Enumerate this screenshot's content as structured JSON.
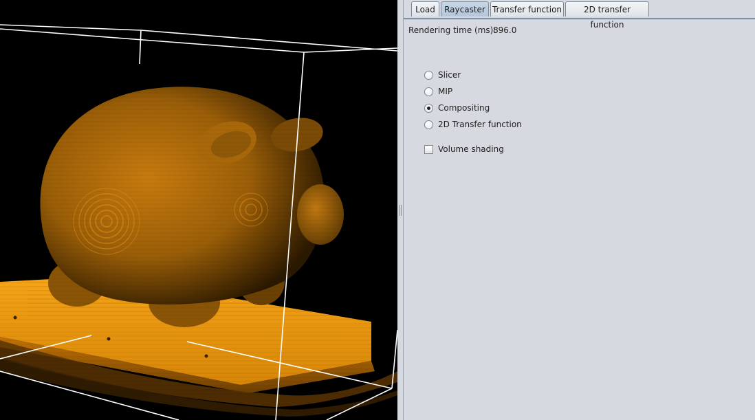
{
  "viewport": {
    "volume_color": "#f29a12",
    "background_color": "#000000",
    "bounding_box_color": "#ffffff"
  },
  "tabs": [
    {
      "label": "Load",
      "selected": false
    },
    {
      "label": "Raycaster",
      "selected": true
    },
    {
      "label": "Transfer function",
      "selected": false
    },
    {
      "label": "2D transfer function",
      "selected": false
    }
  ],
  "raycaster": {
    "rendering_time_label": "Rendering time (ms):",
    "rendering_time_value": "896.0",
    "modes": [
      {
        "label": "Slicer",
        "checked": false
      },
      {
        "label": "MIP",
        "checked": false
      },
      {
        "label": "Compositing",
        "checked": true
      },
      {
        "label": "2D Transfer function",
        "checked": false
      }
    ],
    "volume_shading": {
      "label": "Volume shading",
      "checked": false
    }
  }
}
